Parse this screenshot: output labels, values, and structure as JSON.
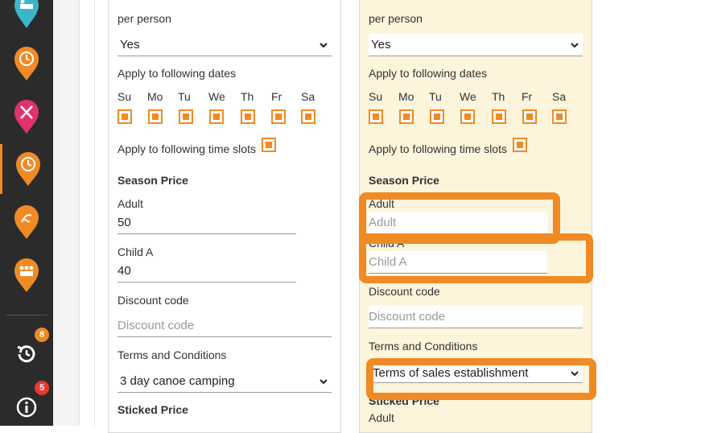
{
  "sidebar": {
    "items": [
      {
        "icon": "bed-icon",
        "color": "#3bb6c8"
      },
      {
        "icon": "clock-icon",
        "color": "#f08a24"
      },
      {
        "icon": "fork-knife-icon",
        "color": "#e0336b"
      },
      {
        "icon": "clock-icon",
        "color": "#f08a24"
      },
      {
        "icon": "hiking-icon",
        "color": "#f08a24"
      },
      {
        "icon": "group-icon",
        "color": "#f08a24"
      }
    ],
    "history_badge": "8",
    "info_badge": "5"
  },
  "left": {
    "per_person_label": "per person",
    "per_person_value": "Yes",
    "dates_label": "Apply to following dates",
    "days": [
      "Su",
      "Mo",
      "Tu",
      "We",
      "Th",
      "Fr",
      "Sa"
    ],
    "timeslots_label": "Apply to following time slots",
    "season_price_label": "Season Price",
    "adult_label": "Adult",
    "adult_value": "50",
    "child_label": "Child A",
    "child_value": "40",
    "discount_label": "Discount code",
    "discount_placeholder": "Discount code",
    "terms_label": "Terms and Conditions",
    "terms_value": "3 day canoe camping",
    "sticked_price_label": "Sticked Price"
  },
  "right": {
    "per_person_label": "per person",
    "per_person_value": "Yes",
    "dates_label": "Apply to following dates",
    "days": [
      "Su",
      "Mo",
      "Tu",
      "We",
      "Th",
      "Fr",
      "Sa"
    ],
    "timeslots_label": "Apply to following time slots",
    "season_price_label": "Season Price",
    "adult_label": "Adult",
    "adult_placeholder": "Adult",
    "child_label": "Child A",
    "child_placeholder": "Child A",
    "discount_label": "Discount code",
    "discount_placeholder": "Discount code",
    "terms_label": "Terms and Conditions",
    "terms_value": "Terms of sales establishment",
    "sticked_price_label": "Sticked Price",
    "sticked_adult_label": "Adult"
  },
  "colors": {
    "accent": "#f08a24",
    "highlight_col": "#fdf4dc",
    "badge": "#e53935"
  }
}
